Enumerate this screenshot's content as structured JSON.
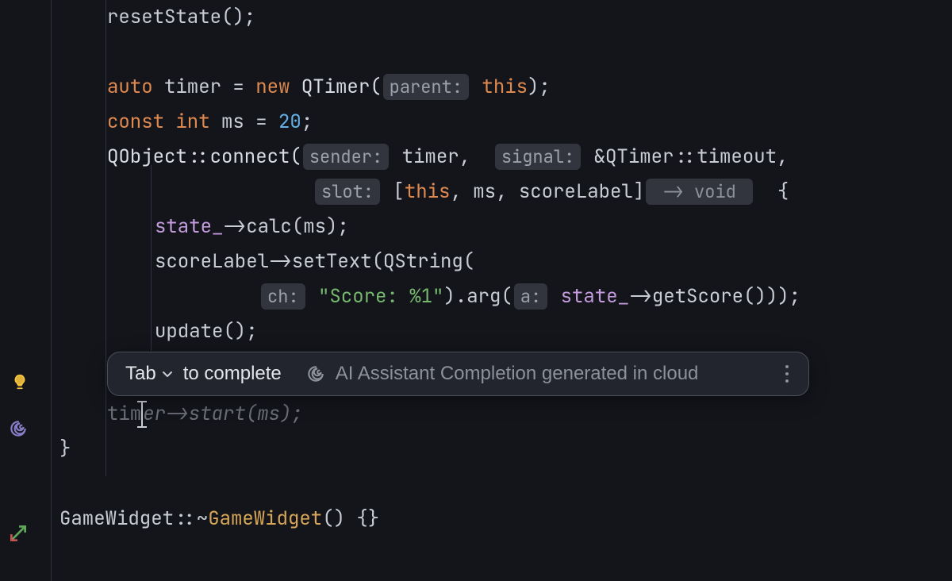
{
  "code": {
    "l1_resetState": "resetState();",
    "l3_auto": "auto",
    "l3_timer_eq_new": " timer = ",
    "l3_new": "new",
    "l3_qtimer": " QTimer(",
    "l3_hint_parent": "parent:",
    "l3_this": " this",
    "l3_close": ");",
    "l4_const": "const",
    "l4_int": " int",
    "l4_ms_eq": " ms = ",
    "l4_num": "20",
    "l4_semi": ";",
    "l5_qobject_connect": "QObject::connect(",
    "l5_hint_sender": "sender:",
    "l5_timer": " timer,  ",
    "l5_hint_signal": "signal:",
    "l5_ref": " &QTimer::timeout,",
    "l6_hint_slot": "slot:",
    "l6_open_lambda": " [",
    "l6_this": "this",
    "l6_ms": ", ms, scoreLabel]",
    "l6_ret_hint": " -> void ",
    "l6_brace": "  {",
    "l7_state": "state_",
    "l7_calc": "->calc(ms);",
    "l8_scoreLabel": "scoreLabel->setText(QString(",
    "l9_hint_ch": "ch:",
    "l9_str": " \"Score: %1\"",
    "l9_arg": ").arg(",
    "l9_hint_a": "a:",
    "l9_state": " state_",
    "l9_getScore": "->getScore()));",
    "l10_update": "update();",
    "ghost_completion": "timer->start(ms);",
    "l_close_brace": "}",
    "l_dtor_prefix": "GameWidget::~",
    "l_dtor_name": "GameWidget",
    "l_dtor_suffix": "() {}"
  },
  "popup": {
    "tab_label": "Tab",
    "to_complete": "to complete",
    "ai_text": "AI Assistant Completion generated in cloud"
  },
  "icons": {
    "bulb": "lightbulb-icon",
    "ai": "ai-spiral-icon",
    "inherit": "inherit-override-icon",
    "chevron": "chevron-down-icon",
    "kebab": "more-vertical-icon"
  }
}
